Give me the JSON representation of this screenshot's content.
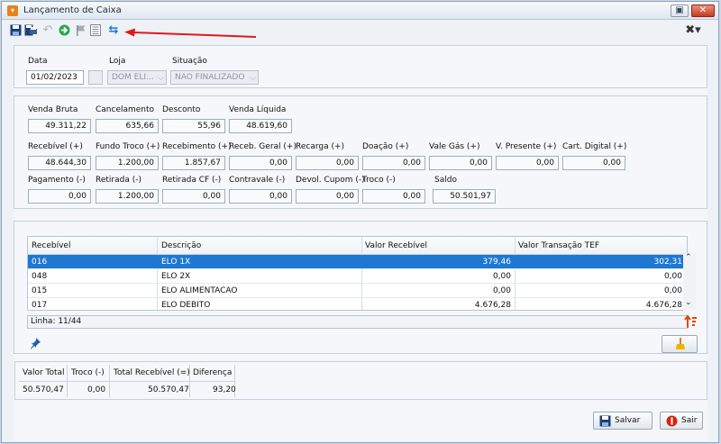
{
  "window": {
    "title": "Lançamento de Caixa",
    "restore_glyph": "▣",
    "close_glyph": "✕"
  },
  "toolbar": {
    "icons": [
      "save-icon",
      "save-print-icon",
      "undo-icon",
      "forward-icon",
      "flag-icon",
      "list-icon",
      "refresh-icon"
    ]
  },
  "header": {
    "data_label": "Data",
    "data_value": "01/02/2023",
    "loja_label": "Loja",
    "loja_value": "DOM ELI...",
    "situacao_label": "Situação",
    "situacao_value": "NAO FINALIZADO"
  },
  "totals": {
    "venda_bruta": {
      "label": "Venda Bruta",
      "value": "49.311,22"
    },
    "cancelamento": {
      "label": "Cancelamento",
      "value": "635,66"
    },
    "desconto": {
      "label": "Desconto",
      "value": "55,96"
    },
    "venda_liquida": {
      "label": "Venda Líquida",
      "value": "48.619,60"
    },
    "recebivel": {
      "label": "Recebível (+)",
      "value": "48.644,30"
    },
    "fundo_troco": {
      "label": "Fundo Troco (+)",
      "value": "1.200,00"
    },
    "recebimento": {
      "label": "Recebimento (+)",
      "value": "1.857,67"
    },
    "receb_geral": {
      "label": "Receb. Geral (+)",
      "value": "0,00"
    },
    "recarga": {
      "label": "Recarga (+)",
      "value": "0,00"
    },
    "doacao": {
      "label": "Doação (+)",
      "value": "0,00"
    },
    "vale_gas": {
      "label": "Vale Gás (+)",
      "value": "0,00"
    },
    "v_presente": {
      "label": "V. Presente (+)",
      "value": "0,00"
    },
    "cart_digital": {
      "label": "Cart. Digital (+)",
      "value": "0,00"
    },
    "pagamento": {
      "label": "Pagamento (-)",
      "value": "0,00"
    },
    "retirada": {
      "label": "Retirada (-)",
      "value": "1.200,00"
    },
    "retirada_cf": {
      "label": "Retirada CF (-)",
      "value": "0,00"
    },
    "contravale": {
      "label": "Contravale (-)",
      "value": "0,00"
    },
    "devol_cupom": {
      "label": "Devol. Cupom (-)",
      "value": "0,00"
    },
    "troco": {
      "label": "Troco (-)",
      "value": "0,00"
    },
    "saldo": {
      "label": "Saldo",
      "value": "50.501,97"
    }
  },
  "table": {
    "headers": [
      "Recebível",
      "Descrição",
      "Valor Recebível",
      "Valor Transação TEF"
    ],
    "rows": [
      {
        "recebivel": "016",
        "descricao": "ELO 1X",
        "valor": "379,46",
        "tef": "302,31"
      },
      {
        "recebivel": "048",
        "descricao": "ELO 2X",
        "valor": "0,00",
        "tef": "0,00"
      },
      {
        "recebivel": "015",
        "descricao": "ELO ALIMENTACAO",
        "valor": "0,00",
        "tef": "0,00"
      },
      {
        "recebivel": "017",
        "descricao": "ELO DEBITO",
        "valor": "4.676,28",
        "tef": "4.676,28"
      }
    ],
    "status": "Linha: 11/44"
  },
  "summary": {
    "headers": [
      "Valor Total",
      "Troco (-)",
      "Total Recebível (=)",
      "Diferença"
    ],
    "values": [
      "50.570,47",
      "0,00",
      "50.570,47",
      "93,20"
    ]
  },
  "buttons": {
    "salvar": "Salvar",
    "sair": "Sair"
  }
}
